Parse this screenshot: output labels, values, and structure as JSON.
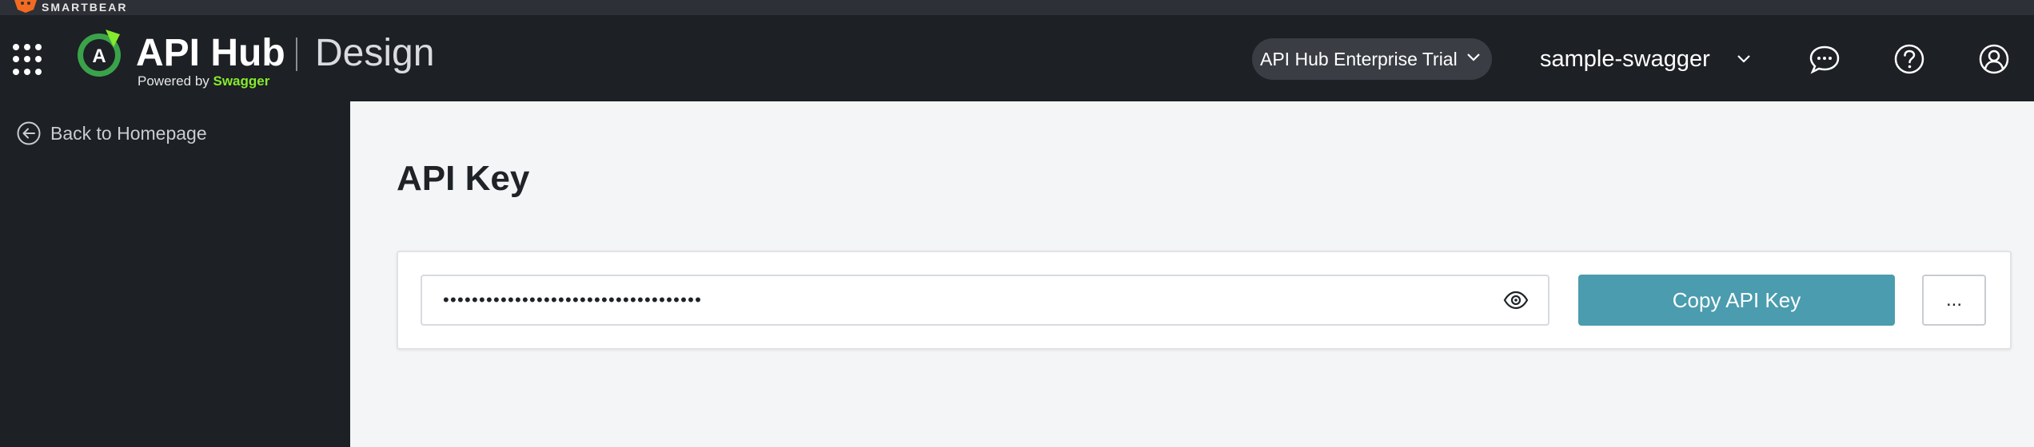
{
  "brandbar": {
    "brand": "SMARTBEAR"
  },
  "header": {
    "logo_title": "API Hub",
    "powered_prefix": "Powered by ",
    "powered_brand": "Swagger",
    "section": "Design",
    "plan": "API Hub Enterprise Trial",
    "workspace": "sample-swagger",
    "icons": [
      "apps-grid-icon",
      "chat-icon",
      "help-icon",
      "user-icon"
    ]
  },
  "sidebar": {
    "back_label": "Back to Homepage"
  },
  "main": {
    "title": "API Key",
    "key_masked": "••••••••••••••••••••••••••••••••••••",
    "copy_label": "Copy API Key",
    "more_label": "..."
  },
  "colors": {
    "accent": "#4a9cae",
    "swagger_green": "#85ea2d",
    "nav_bg": "#1d2024"
  }
}
